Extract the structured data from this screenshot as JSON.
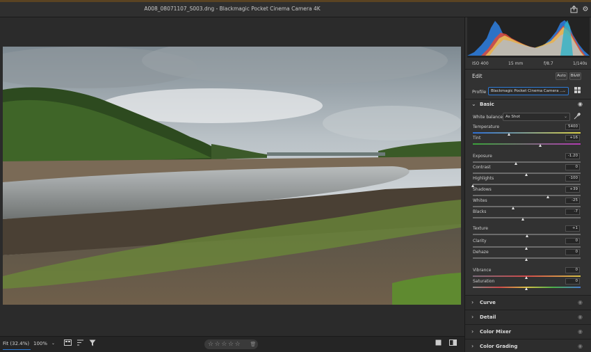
{
  "window": {
    "title": "A008_08071107_S003.dng  -  Blackmagic Pocket Cinema Camera 4K"
  },
  "toolbar_icons": [
    "export-icon",
    "gear-icon"
  ],
  "camera_info": {
    "iso": "ISO 400",
    "focal": "15 mm",
    "aperture": "f/8.7",
    "shutter": "1/140s"
  },
  "edit": {
    "title": "Edit",
    "auto_label": "Auto",
    "bw_label": "B&W"
  },
  "profile": {
    "label": "Profile",
    "value": "Blackmagic Pocket Cinema Camera ..."
  },
  "basic": {
    "title": "Basic",
    "white_balance": {
      "label": "White balance",
      "value": "As Shot"
    },
    "sliders": [
      {
        "name": "Temperature",
        "value": "5400",
        "pos": 0.34,
        "track": "temp"
      },
      {
        "name": "Tint",
        "value": "+16",
        "pos": 0.63,
        "track": "tint"
      },
      {
        "name": "Exposure",
        "value": "-1.20",
        "pos": 0.4,
        "track": "plain"
      },
      {
        "name": "Contrast",
        "value": "0",
        "pos": 0.5,
        "track": "plain"
      },
      {
        "name": "Highlights",
        "value": "-100",
        "pos": 0.0,
        "track": "plain"
      },
      {
        "name": "Shadows",
        "value": "+39",
        "pos": 0.7,
        "track": "plain"
      },
      {
        "name": "Whites",
        "value": "-25",
        "pos": 0.375,
        "track": "plain"
      },
      {
        "name": "Blacks",
        "value": "-7",
        "pos": 0.465,
        "track": "plain"
      },
      {
        "name": "Texture",
        "value": "+1",
        "pos": 0.505,
        "track": "plain"
      },
      {
        "name": "Clarity",
        "value": "0",
        "pos": 0.5,
        "track": "plain"
      },
      {
        "name": "Dehaze",
        "value": "0",
        "pos": 0.5,
        "track": "plain"
      },
      {
        "name": "Vibrance",
        "value": "0",
        "pos": 0.5,
        "track": "vib"
      },
      {
        "name": "Saturation",
        "value": "0",
        "pos": 0.5,
        "track": "sat"
      }
    ]
  },
  "sections": [
    {
      "name": "Curve"
    },
    {
      "name": "Detail"
    },
    {
      "name": "Color Mixer"
    },
    {
      "name": "Color Grading"
    }
  ],
  "bottom": {
    "fit_label": "Fit (32.4%)",
    "zoom_label": "100%"
  },
  "colors": {
    "accent": "#2d7bd8",
    "panel": "#323232",
    "canvas": "#2b2b2b"
  }
}
